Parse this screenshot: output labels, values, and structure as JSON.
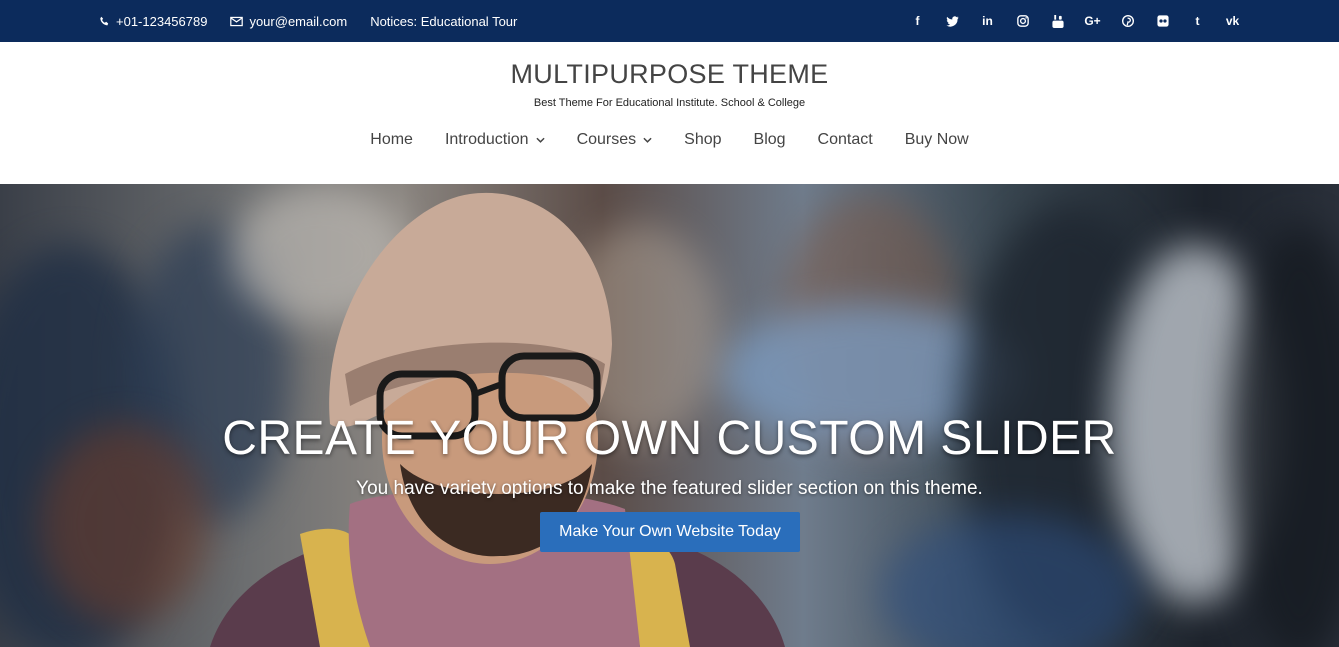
{
  "topbar": {
    "phone": "+01-123456789",
    "email": "your@email.com",
    "notice": "Notices: Educational Tour",
    "social": [
      {
        "icon": "facebook-icon",
        "glyph": "f"
      },
      {
        "icon": "twitter-icon",
        "glyph": ""
      },
      {
        "icon": "linkedin-icon",
        "glyph": "in"
      },
      {
        "icon": "instagram-icon",
        "glyph": ""
      },
      {
        "icon": "youtube-icon",
        "glyph": ""
      },
      {
        "icon": "google-plus-icon",
        "glyph": "G+"
      },
      {
        "icon": "pinterest-icon",
        "glyph": ""
      },
      {
        "icon": "flickr-icon",
        "glyph": ""
      },
      {
        "icon": "tumblr-icon",
        "glyph": "t"
      },
      {
        "icon": "vk-icon",
        "glyph": "vk"
      }
    ]
  },
  "header": {
    "title": "MULTIPURPOSE THEME",
    "tagline": "Best Theme For Educational Institute. School & College"
  },
  "nav": {
    "items": [
      {
        "label": "Home",
        "dropdown": false
      },
      {
        "label": "Introduction",
        "dropdown": true
      },
      {
        "label": "Courses",
        "dropdown": true
      },
      {
        "label": "Shop",
        "dropdown": false
      },
      {
        "label": "Blog",
        "dropdown": false
      },
      {
        "label": "Contact",
        "dropdown": false
      },
      {
        "label": "Buy Now",
        "dropdown": false
      }
    ]
  },
  "hero": {
    "title": "CREATE YOUR OWN CUSTOM SLIDER",
    "subtitle": "You have variety options to make the featured slider section on this theme.",
    "button": "Make Your Own Website Today"
  },
  "colors": {
    "topbar_bg": "#0c2b5c",
    "button_bg": "#2a6ebb"
  }
}
